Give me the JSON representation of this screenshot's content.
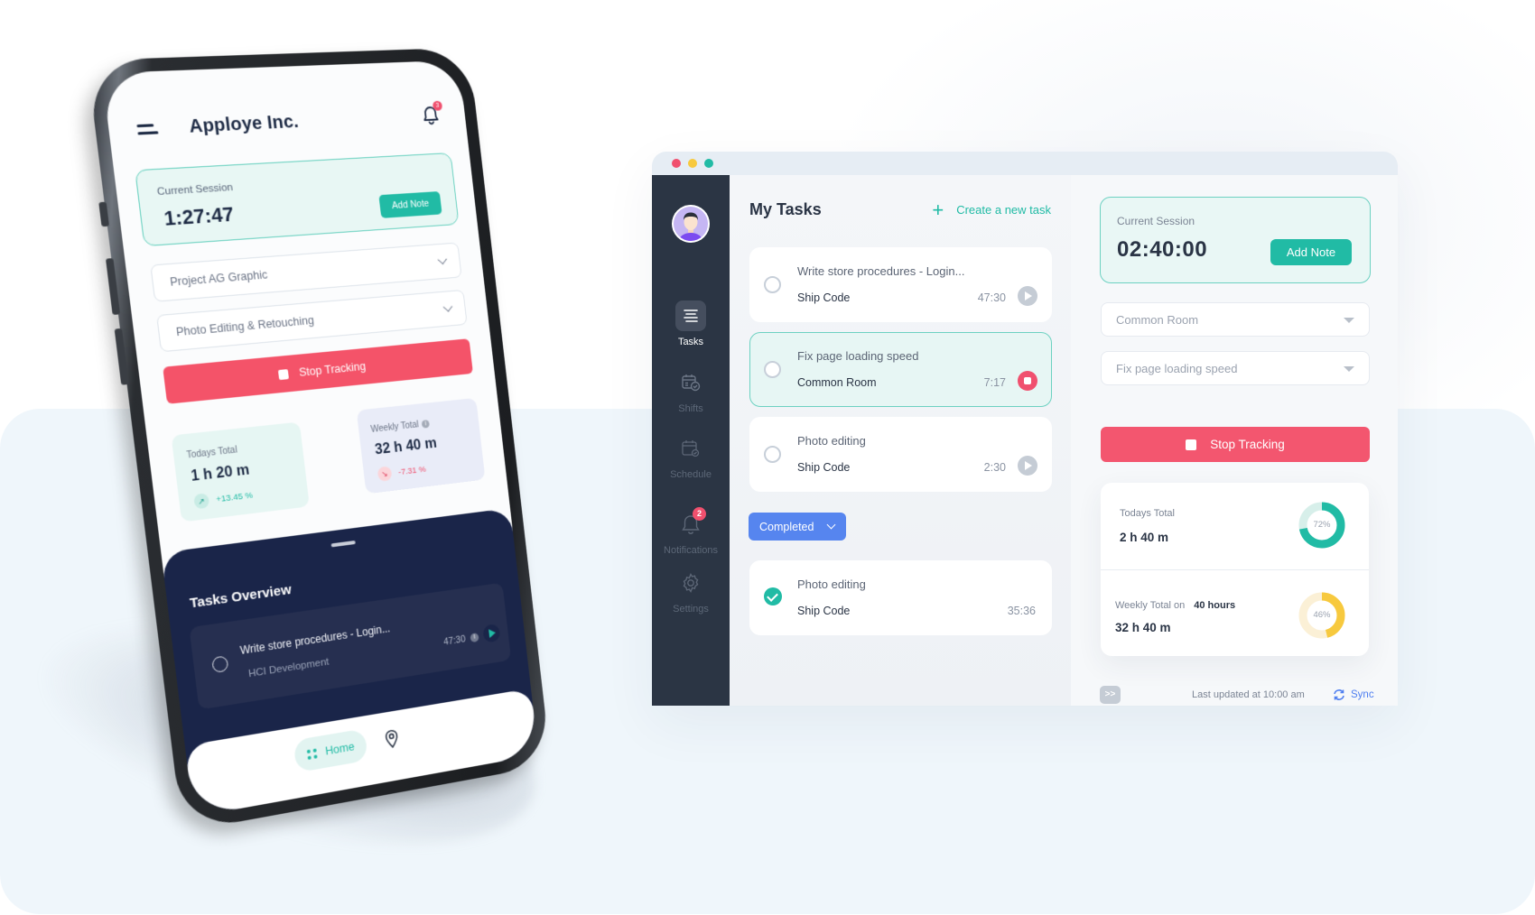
{
  "mobile_app": {
    "header": {
      "title": "Apploye Inc.",
      "notification_count": "3"
    },
    "current_session": {
      "label": "Current Session",
      "time": "1:27:47",
      "add_note_label": "Add Note"
    },
    "project_select": {
      "value": "Project AG Graphic"
    },
    "task_select": {
      "value": "Photo Editing & Retouching"
    },
    "stop_tracking_label": "Stop Tracking",
    "todays_total": {
      "label": "Todays Total",
      "value": "1 h 20 m",
      "change": "+13.45 %",
      "trend": "up"
    },
    "weekly_total": {
      "label": "Weekly Total",
      "value": "32 h 40 m",
      "change": "-7.31 %",
      "trend": "down"
    },
    "tasks_overview": {
      "title": "Tasks Overview",
      "tasks": [
        {
          "title": "Write store procedures - Login...",
          "project": "HCI Development",
          "time": "47:30"
        }
      ]
    },
    "bottom_nav": {
      "home_label": "Home"
    }
  },
  "desktop_app": {
    "window_controls": {
      "close_color": "#f0506e",
      "minimize_color": "#f7c93e",
      "maximize_color": "#21bba5"
    },
    "sidebar": {
      "items": [
        {
          "label": "Tasks",
          "icon": "tasks-icon",
          "active": true
        },
        {
          "label": "Shifts",
          "icon": "shifts-icon",
          "active": false
        },
        {
          "label": "Schedule",
          "icon": "schedule-icon",
          "active": false
        },
        {
          "label": "Notifications",
          "icon": "bell-icon",
          "active": false,
          "badge": "2"
        },
        {
          "label": "Settings",
          "icon": "gear-icon",
          "active": false
        }
      ]
    },
    "tasks": {
      "title": "My Tasks",
      "create_label": "Create a new task",
      "open": [
        {
          "title": "Write store procedures - Login...",
          "project": "Ship Code",
          "time": "47:30",
          "state": "paused"
        },
        {
          "title": "Fix page loading speed",
          "project": "Common Room",
          "time": "7:17",
          "state": "running"
        },
        {
          "title": "Photo editing",
          "project": "Ship Code",
          "time": "2:30",
          "state": "paused"
        }
      ],
      "completed_toggle_label": "Completed",
      "completed": [
        {
          "title": "Photo editing",
          "project": "Ship Code",
          "time": "35:36"
        }
      ]
    },
    "session_panel": {
      "current_session_label": "Current Session",
      "time": "02:40:00",
      "add_note_label": "Add Note",
      "project_select": "Common Room",
      "task_select": "Fix page loading speed",
      "stop_tracking_label": "Stop Tracking",
      "todays_total": {
        "label": "Todays Total",
        "value": "2 h 40 m",
        "percent": 72,
        "percent_label": "72%",
        "color": "#21bba5",
        "track_color": "#d7efea"
      },
      "weekly_total": {
        "label": "Weekly Total on",
        "target": "40 hours",
        "value": "32 h 40 m",
        "percent": 46,
        "percent_label": "46%",
        "color": "#f7c93e",
        "track_color": "#fbf0d6"
      },
      "footer": {
        "expand_label": ">>",
        "last_updated": "Last updated at 10:00 am",
        "sync_label": "Sync"
      }
    }
  },
  "colors": {
    "accent": "#21bba5",
    "danger": "#f3566f",
    "primary_blue": "#5685ef",
    "sidebar_bg": "#2b3544",
    "mobile_sheet_bg": "#1a2549"
  }
}
